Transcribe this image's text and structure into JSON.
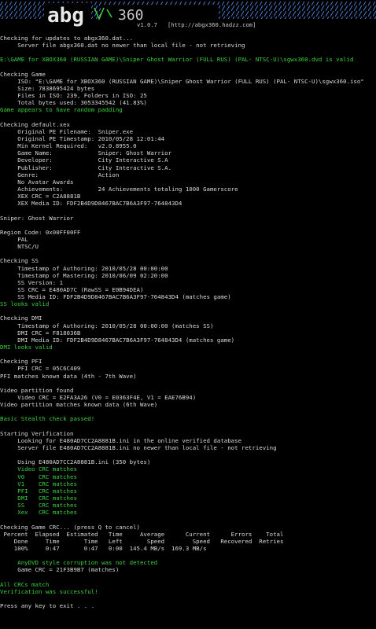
{
  "banner": {
    "logo_text": "abg",
    "logo_suffix": "360",
    "version": "v1.0.7",
    "url": "[http://abgx360.hadzz.com]"
  },
  "lines": [
    {
      "t": "Checking for updates to abgx360.dat...",
      "c": "w"
    },
    {
      "t": "     Server file abgx360.dat no newer than local file - not retrieving",
      "c": "w"
    },
    {
      "t": "",
      "c": "w"
    },
    {
      "t": "E:\\GAME for XBOX360 (RUSSIAN GAME)\\Sniper Ghost Warrior (FULL RUS) (PAL- NTSC-U)\\sgwx360.dvd is valid",
      "c": "g"
    },
    {
      "t": "",
      "c": "w"
    },
    {
      "t": "Checking Game",
      "c": "w"
    },
    {
      "t": "     ISO: \"E:\\GAME for XBOX360 (RUSSIAN GAME)\\Sniper Ghost Warrior (FULL RUS) (PAL- NTSC-U)\\sgwx360.iso\"",
      "c": "w"
    },
    {
      "t": "     Size: 7838695424 bytes",
      "c": "w"
    },
    {
      "t": "     Files in ISO: 239, Folders in ISO: 25",
      "c": "w"
    },
    {
      "t": "     Total bytes used: 3053345542 (41.83%)",
      "c": "w"
    },
    {
      "t": "Game appears to have random padding",
      "c": "g"
    },
    {
      "t": "",
      "c": "w"
    },
    {
      "t": "Checking default.xex",
      "c": "w"
    },
    {
      "t": "     Original PE Filename:  Sniper.exe",
      "c": "w"
    },
    {
      "t": "     Original PE Timestamp: 2010/05/28 12:01:44",
      "c": "w"
    },
    {
      "t": "     Min Kernel Required:   v2.0.8955.0",
      "c": "w"
    },
    {
      "t": "     Game Name:             Sniper: Ghost Warrior",
      "c": "w"
    },
    {
      "t": "     Developer:             City Interactive S.A",
      "c": "w"
    },
    {
      "t": "     Publisher:             City Interactive S.A.",
      "c": "w"
    },
    {
      "t": "     Genre:                 Action",
      "c": "w"
    },
    {
      "t": "     No Avatar Awards",
      "c": "w"
    },
    {
      "t": "     Achievements:          24 Achievements totaling 1000 Gamerscore",
      "c": "w"
    },
    {
      "t": "     XEX CRC = C2A8881B",
      "c": "w"
    },
    {
      "t": "     XEX Media ID: FDF2B4D9D8467BAC7B6A3F97-764843D4",
      "c": "w"
    },
    {
      "t": "",
      "c": "w"
    },
    {
      "t": "Sniper: Ghost Warrior",
      "c": "w"
    },
    {
      "t": "",
      "c": "w"
    },
    {
      "t": "Region Code: 0x00FF00FF",
      "c": "w"
    },
    {
      "t": "     PAL",
      "c": "w"
    },
    {
      "t": "     NTSC/U",
      "c": "w"
    },
    {
      "t": "",
      "c": "w"
    },
    {
      "t": "Checking SS",
      "c": "w"
    },
    {
      "t": "     Timestamp of Authoring: 2010/05/28 00:00:00",
      "c": "w"
    },
    {
      "t": "     Timestamp of Mastering: 2010/06/09 02:20:00",
      "c": "w"
    },
    {
      "t": "     SS Version: 1",
      "c": "w"
    },
    {
      "t": "     SS CRC = E480AD7C (RawSS = E0B94DEA)",
      "c": "w"
    },
    {
      "t": "     SS Media ID: FDF2B4D9D8467BAC7B6A3F97-764843D4 (matches game)",
      "c": "w"
    },
    {
      "t": "SS looks valid",
      "c": "g"
    },
    {
      "t": "",
      "c": "w"
    },
    {
      "t": "Checking DMI",
      "c": "w"
    },
    {
      "t": "     Timestamp of Authoring: 2010/05/28 00:00:00 (matches SS)",
      "c": "w"
    },
    {
      "t": "     DMI CRC = F818036B",
      "c": "w"
    },
    {
      "t": "     DMI Media ID: FDF2B4D9D8467BAC7B6A3F97-764843D4 (matches game)",
      "c": "w"
    },
    {
      "t": "DMI looks valid",
      "c": "g"
    },
    {
      "t": "",
      "c": "w"
    },
    {
      "t": "Checking PFI",
      "c": "w"
    },
    {
      "t": "     PFI CRC = 05C6C409",
      "c": "w"
    },
    {
      "t": "PFI matches known data (4th - 7th Wave)",
      "c": "w"
    },
    {
      "t": "",
      "c": "w"
    },
    {
      "t": "Video partition found",
      "c": "w"
    },
    {
      "t": "     Video CRC = E2FA3A26 (V0 = E0363F4E, V1 = EAE76B94)",
      "c": "w"
    },
    {
      "t": "Video partition matches known data (6th Wave)",
      "c": "w"
    },
    {
      "t": "",
      "c": "w"
    },
    {
      "t": "Basic Stealth check passed!",
      "c": "g"
    },
    {
      "t": "",
      "c": "w"
    },
    {
      "t": "Starting Verification",
      "c": "w"
    },
    {
      "t": "     Looking for E480AD7CC2A8881B.ini in the online verified database",
      "c": "w"
    },
    {
      "t": "     Server file E480AD7CC2A8881B.ini no newer than local file - not retrieving",
      "c": "w"
    },
    {
      "t": "",
      "c": "w"
    },
    {
      "t": "     Using E480AD7CC2A8881B.ini (350 bytes)",
      "c": "w"
    },
    {
      "t": "     Video CRC matches",
      "c": "g"
    },
    {
      "t": "     V0    CRC matches",
      "c": "g"
    },
    {
      "t": "     V1    CRC matches",
      "c": "g"
    },
    {
      "t": "     PFI   CRC matches",
      "c": "g"
    },
    {
      "t": "     DMI   CRC matches",
      "c": "g"
    },
    {
      "t": "     SS    CRC matches",
      "c": "g"
    },
    {
      "t": "     Xex   CRC matches",
      "c": "g"
    },
    {
      "t": "",
      "c": "w"
    },
    {
      "t": "Checking Game CRC... (press Q to cancel)",
      "c": "w"
    },
    {
      "t": " Percent  Elapsed  Estimated   Time     Average      Current      Errors    Total",
      "c": "w"
    },
    {
      "t": "    Done     Time       Time   Left       Speed        Speed   Recovered  Retries",
      "c": "w"
    },
    {
      "t": "    100%     0:47       0:47   0:00  145.4 MB/s  169.3 MB/s",
      "c": "w"
    },
    {
      "t": "",
      "c": "w"
    },
    {
      "t": "     AnyDVD style corruption was not detected",
      "c": "g"
    },
    {
      "t": "     Game CRC = 21F3B9B7 (matches)",
      "c": "w"
    },
    {
      "t": "",
      "c": "w"
    },
    {
      "t": "All CRCs match",
      "c": "g"
    },
    {
      "t": "Verification was successful!",
      "c": "g"
    },
    {
      "t": "",
      "c": "w"
    },
    {
      "t": "Press any key to exit . . .",
      "c": "w"
    }
  ]
}
